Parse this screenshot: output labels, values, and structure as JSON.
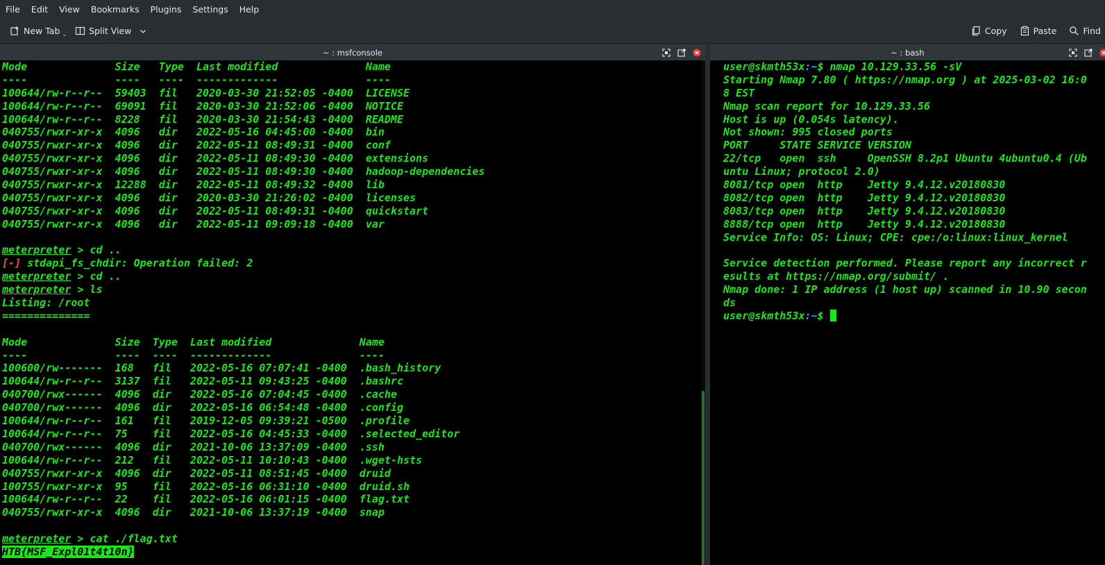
{
  "menubar": {
    "items": [
      "File",
      "Edit",
      "View",
      "Bookmarks",
      "Plugins",
      "Settings",
      "Help"
    ]
  },
  "toolbar": {
    "new_tab": "New Tab",
    "split_view": "Split View",
    "copy": "Copy",
    "paste": "Paste",
    "find": "Find"
  },
  "left_pane": {
    "title": "~ : msfconsole",
    "listing1": {
      "header": [
        "Mode",
        "Size",
        "Type",
        "Last modified",
        "Name"
      ],
      "sep": [
        "----",
        "----",
        "----",
        "-------------",
        "----"
      ],
      "rows": [
        [
          "100644/rw-r--r--",
          "59403",
          "fil",
          "2020-03-30 21:52:05 -0400",
          "LICENSE"
        ],
        [
          "100644/rw-r--r--",
          "69091",
          "fil",
          "2020-03-30 21:52:06 -0400",
          "NOTICE"
        ],
        [
          "100644/rw-r--r--",
          "8228",
          "fil",
          "2020-03-30 21:54:43 -0400",
          "README"
        ],
        [
          "040755/rwxr-xr-x",
          "4096",
          "dir",
          "2022-05-16 04:45:00 -0400",
          "bin"
        ],
        [
          "040755/rwxr-xr-x",
          "4096",
          "dir",
          "2022-05-11 08:49:31 -0400",
          "conf"
        ],
        [
          "040755/rwxr-xr-x",
          "4096",
          "dir",
          "2022-05-11 08:49:30 -0400",
          "extensions"
        ],
        [
          "040755/rwxr-xr-x",
          "4096",
          "dir",
          "2022-05-11 08:49:30 -0400",
          "hadoop-dependencies"
        ],
        [
          "040755/rwxr-xr-x",
          "12288",
          "dir",
          "2022-05-11 08:49:32 -0400",
          "lib"
        ],
        [
          "040755/rwxr-xr-x",
          "4096",
          "dir",
          "2020-03-30 21:26:02 -0400",
          "licenses"
        ],
        [
          "040755/rwxr-xr-x",
          "4096",
          "dir",
          "2022-05-11 08:49:31 -0400",
          "quickstart"
        ],
        [
          "040755/rwxr-xr-x",
          "4096",
          "dir",
          "2022-05-11 09:09:18 -0400",
          "var"
        ]
      ]
    },
    "prompt": "meterpreter",
    "cmd_cd1": " > cd ..",
    "err_tag": "[-]",
    "err_msg": " stdapi_fs_chdir: Operation failed: 2",
    "cmd_cd2": " > cd ..",
    "cmd_ls": " > ls",
    "listing_title": "Listing: /root",
    "listing_rule": "==============",
    "listing2": {
      "header": [
        "Mode",
        "Size",
        "Type",
        "Last modified",
        "Name"
      ],
      "sep": [
        "----",
        "----",
        "----",
        "-------------",
        "----"
      ],
      "rows": [
        [
          "100600/rw-------",
          "168",
          "fil",
          "2022-05-16 07:07:41 -0400",
          ".bash_history"
        ],
        [
          "100644/rw-r--r--",
          "3137",
          "fil",
          "2022-05-11 09:43:25 -0400",
          ".bashrc"
        ],
        [
          "040700/rwx------",
          "4096",
          "dir",
          "2022-05-16 07:04:45 -0400",
          ".cache"
        ],
        [
          "040700/rwx------",
          "4096",
          "dir",
          "2022-05-16 06:54:48 -0400",
          ".config"
        ],
        [
          "100644/rw-r--r--",
          "161",
          "fil",
          "2019-12-05 09:39:21 -0500",
          ".profile"
        ],
        [
          "100644/rw-r--r--",
          "75",
          "fil",
          "2022-05-16 04:45:33 -0400",
          ".selected_editor"
        ],
        [
          "040700/rwx------",
          "4096",
          "dir",
          "2021-10-06 13:37:09 -0400",
          ".ssh"
        ],
        [
          "100644/rw-r--r--",
          "212",
          "fil",
          "2022-05-11 10:10:43 -0400",
          ".wget-hsts"
        ],
        [
          "040755/rwxr-xr-x",
          "4096",
          "dir",
          "2022-05-11 08:51:45 -0400",
          "druid"
        ],
        [
          "100755/rwxr-xr-x",
          "95",
          "fil",
          "2022-05-16 06:31:10 -0400",
          "druid.sh"
        ],
        [
          "100644/rw-r--r--",
          "22",
          "fil",
          "2022-05-16 06:01:15 -0400",
          "flag.txt"
        ],
        [
          "040755/rwxr-xr-x",
          "4096",
          "dir",
          "2021-10-06 13:37:19 -0400",
          "snap"
        ]
      ]
    },
    "cmd_cat": " > cat ./flag.txt",
    "flag": "HTB{MSF_Expl01t4t10n}"
  },
  "right_pane": {
    "title": "~ : bash",
    "user": "user@skmth53x",
    "path": ":~",
    "cmd": "$ nmap 10.129.33.56 -sV",
    "lines": [
      "Starting Nmap 7.80 ( https://nmap.org ) at 2025-03-02 16:0",
      "8 EST",
      "Nmap scan report for 10.129.33.56",
      "Host is up (0.054s latency).",
      "Not shown: 995 closed ports",
      "PORT     STATE SERVICE VERSION",
      "22/tcp   open  ssh     OpenSSH 8.2p1 Ubuntu 4ubuntu0.4 (Ub",
      "untu Linux; protocol 2.0)",
      "8081/tcp open  http    Jetty 9.4.12.v20180830",
      "8082/tcp open  http    Jetty 9.4.12.v20180830",
      "8083/tcp open  http    Jetty 9.4.12.v20180830",
      "8888/tcp open  http    Jetty 9.4.12.v20180830",
      "Service Info: OS: Linux; CPE: cpe:/o:linux:linux_kernel",
      "",
      "Service detection performed. Please report any incorrect r",
      "esults at https://nmap.org/submit/ .",
      "Nmap done: 1 IP address (1 host up) scanned in 10.90 secon",
      "ds"
    ],
    "prompt_end": "$ "
  },
  "colors": {
    "terminal_green": "#18e818",
    "path_blue": "#2ba0ff",
    "error_red": "#ff4a4a",
    "close_red": "#e8413c"
  }
}
